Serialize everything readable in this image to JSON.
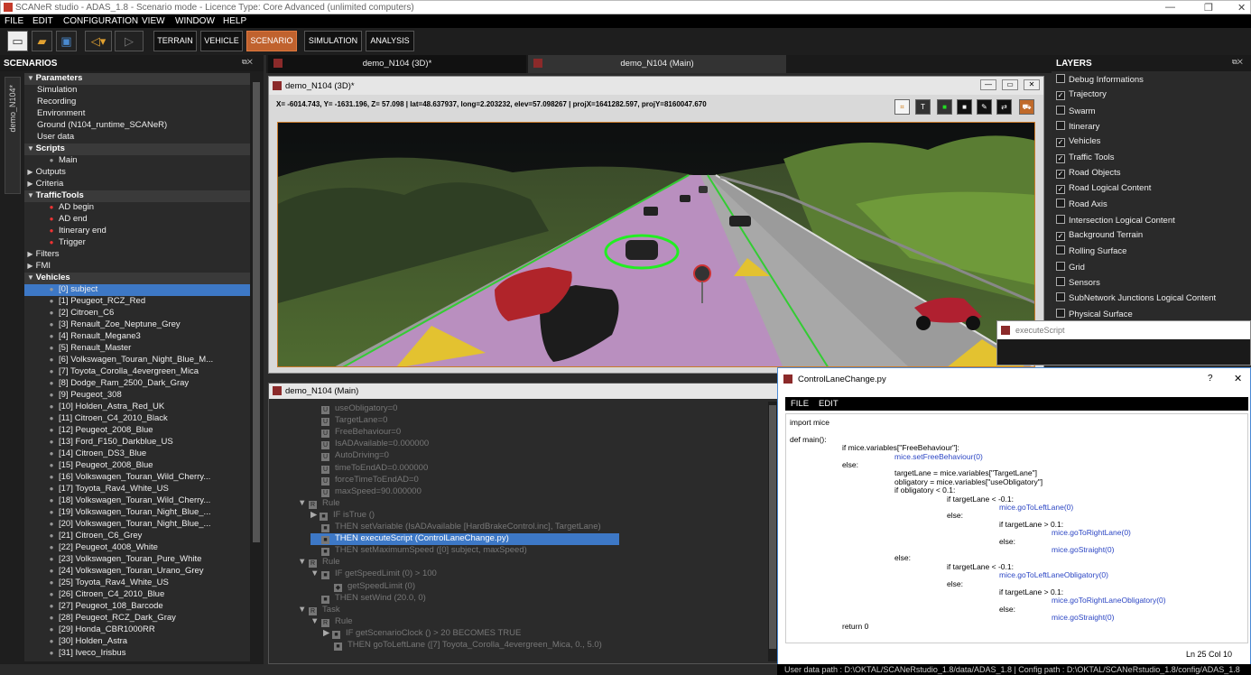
{
  "title": "SCANeR studio - ADAS_1.8 - Scenario mode - Licence Type: Core Advanced (unlimited computers)",
  "menu": [
    "FILE",
    "EDIT",
    "CONFIGURATION",
    "VIEW",
    "WINDOW",
    "HELP"
  ],
  "toolbar": {
    "modes": [
      "TERRAIN",
      "VEHICLE",
      "SCENARIO",
      "SIMULATION",
      "ANALYSIS"
    ],
    "active_mode": "SCENARIO"
  },
  "scenarios": {
    "header": "SCENARIOS",
    "vertical_tab": "demo_N104*",
    "tree": [
      {
        "label": "Parameters",
        "kind": "section",
        "indent": 0
      },
      {
        "label": "Simulation",
        "kind": "item",
        "indent": 1
      },
      {
        "label": "Recording",
        "kind": "item",
        "indent": 1
      },
      {
        "label": "Environment",
        "kind": "item",
        "indent": 1
      },
      {
        "label": "Ground (N104_runtime_SCANeR)",
        "kind": "item",
        "indent": 1
      },
      {
        "label": "User data",
        "kind": "item",
        "indent": 1
      },
      {
        "label": "Scripts",
        "kind": "section",
        "indent": 0
      },
      {
        "label": "Main",
        "kind": "item",
        "indent": 2
      },
      {
        "label": "Outputs",
        "kind": "plain",
        "indent": 0
      },
      {
        "label": "Criteria",
        "kind": "plain",
        "indent": 0
      },
      {
        "label": "TrafficTools",
        "kind": "section",
        "indent": 0
      },
      {
        "label": "AD begin",
        "kind": "item",
        "indent": 2
      },
      {
        "label": "AD end",
        "kind": "item",
        "indent": 2
      },
      {
        "label": "Itinerary end",
        "kind": "item",
        "indent": 2
      },
      {
        "label": "Trigger",
        "kind": "item",
        "indent": 2
      },
      {
        "label": "Filters",
        "kind": "plain",
        "indent": 0
      },
      {
        "label": "FMI",
        "kind": "plain",
        "indent": 0
      },
      {
        "label": "Vehicles",
        "kind": "section",
        "indent": 0
      },
      {
        "label": "[0] subject",
        "kind": "selected",
        "indent": 2
      },
      {
        "label": "[1] Peugeot_RCZ_Red",
        "kind": "item",
        "indent": 2
      },
      {
        "label": "[2] Citroen_C6",
        "kind": "item",
        "indent": 2
      },
      {
        "label": "[3] Renault_Zoe_Neptune_Grey",
        "kind": "item",
        "indent": 2
      },
      {
        "label": "[4] Renault_Megane3",
        "kind": "item",
        "indent": 2
      },
      {
        "label": "[5] Renault_Master",
        "kind": "item",
        "indent": 2
      },
      {
        "label": "[6] Volkswagen_Touran_Night_Blue_M...",
        "kind": "item",
        "indent": 2
      },
      {
        "label": "[7] Toyota_Corolla_4evergreen_Mica",
        "kind": "item",
        "indent": 2
      },
      {
        "label": "[8] Dodge_Ram_2500_Dark_Gray",
        "kind": "item",
        "indent": 2
      },
      {
        "label": "[9] Peugeot_308",
        "kind": "item",
        "indent": 2
      },
      {
        "label": "[10] Holden_Astra_Red_UK",
        "kind": "item",
        "indent": 2
      },
      {
        "label": "[11] Citroen_C4_2010_Black",
        "kind": "item",
        "indent": 2
      },
      {
        "label": "[12] Peugeot_2008_Blue",
        "kind": "item",
        "indent": 2
      },
      {
        "label": "[13] Ford_F150_Darkblue_US",
        "kind": "item",
        "indent": 2
      },
      {
        "label": "[14] Citroen_DS3_Blue",
        "kind": "item",
        "indent": 2
      },
      {
        "label": "[15] Peugeot_2008_Blue",
        "kind": "item",
        "indent": 2
      },
      {
        "label": "[16] Volkswagen_Touran_Wild_Cherry...",
        "kind": "item",
        "indent": 2
      },
      {
        "label": "[17] Toyota_Rav4_White_US",
        "kind": "item",
        "indent": 2
      },
      {
        "label": "[18] Volkswagen_Touran_Wild_Cherry...",
        "kind": "item",
        "indent": 2
      },
      {
        "label": "[19] Volkswagen_Touran_Night_Blue_...",
        "kind": "item",
        "indent": 2
      },
      {
        "label": "[20] Volkswagen_Touran_Night_Blue_...",
        "kind": "item",
        "indent": 2
      },
      {
        "label": "[21] Citroen_C6_Grey",
        "kind": "item",
        "indent": 2
      },
      {
        "label": "[22] Peugeot_4008_White",
        "kind": "item",
        "indent": 2
      },
      {
        "label": "[23] Volkswagen_Touran_Pure_White",
        "kind": "item",
        "indent": 2
      },
      {
        "label": "[24] Volkswagen_Touran_Urano_Grey",
        "kind": "item",
        "indent": 2
      },
      {
        "label": "[25] Toyota_Rav4_White_US",
        "kind": "item",
        "indent": 2
      },
      {
        "label": "[26] Citroen_C4_2010_Blue",
        "kind": "item",
        "indent": 2
      },
      {
        "label": "[27] Peugeot_108_Barcode",
        "kind": "item",
        "indent": 2
      },
      {
        "label": "[28] Peugeot_RCZ_Dark_Gray",
        "kind": "item",
        "indent": 2
      },
      {
        "label": "[29] Honda_CBR1000RR",
        "kind": "item",
        "indent": 2
      },
      {
        "label": "[30] Holden_Astra",
        "kind": "item",
        "indent": 2
      },
      {
        "label": "[31] Iveco_Irisbus",
        "kind": "item",
        "indent": 2
      }
    ]
  },
  "doc_tabs": [
    "demo_N104 (3D)*",
    "demo_N104 (Main)"
  ],
  "view3d": {
    "title": "demo_N104 (3D)*",
    "coords": "X= -6014.743, Y= -1631.196, Z=  57.098 | lat=48.637937, long=2.203232, elev=57.098267 | projX=1641282.597, projY=8160047.670",
    "tool_buttons": [
      "frame-icon",
      "T",
      "green-square-icon",
      "white-square-icon",
      "edit-icon",
      "tow-icon",
      "car-icon"
    ]
  },
  "layers": {
    "header": "LAYERS",
    "items": [
      {
        "label": "Debug Informations",
        "checked": false
      },
      {
        "label": "Trajectory",
        "checked": true
      },
      {
        "label": "Swarm",
        "checked": false
      },
      {
        "label": "Itinerary",
        "checked": false
      },
      {
        "label": "Vehicles",
        "checked": true
      },
      {
        "label": "Traffic Tools",
        "checked": true
      },
      {
        "label": "Road Objects",
        "checked": true
      },
      {
        "label": "Road Logical Content",
        "checked": true
      },
      {
        "label": "Road Axis",
        "checked": false
      },
      {
        "label": "Intersection Logical Content",
        "checked": false
      },
      {
        "label": "Background Terrain",
        "checked": true
      },
      {
        "label": "Rolling Surface",
        "checked": false
      },
      {
        "label": "Grid",
        "checked": false
      },
      {
        "label": "Sensors",
        "checked": false
      },
      {
        "label": "SubNetwork Junctions Logical Content",
        "checked": false
      },
      {
        "label": "Physical Surface",
        "checked": false
      }
    ]
  },
  "main_view": {
    "title": "demo_N104 (Main)",
    "rows": [
      {
        "text": "useObligatory=0",
        "indent": 2,
        "style": "dim",
        "icon": "U"
      },
      {
        "text": "TargetLane=0",
        "indent": 2,
        "style": "dim",
        "icon": "U"
      },
      {
        "text": "FreeBehaviour=0",
        "indent": 2,
        "style": "dim",
        "icon": "U"
      },
      {
        "text": "IsADAvailable=0.000000",
        "indent": 2,
        "style": "dim",
        "icon": "U"
      },
      {
        "text": "AutoDriving=0",
        "indent": 2,
        "style": "dim",
        "icon": "U"
      },
      {
        "text": "timeToEndAD=0.000000",
        "indent": 2,
        "style": "dim",
        "icon": "U"
      },
      {
        "text": "forceTimeToEndAD=0",
        "indent": 2,
        "style": "dim",
        "icon": "U"
      },
      {
        "text": "maxSpeed=90.000000",
        "indent": 2,
        "style": "dim",
        "icon": "U"
      },
      {
        "text": "Rule",
        "indent": 1,
        "style": "dim",
        "icon": "R",
        "arrow": "▼"
      },
      {
        "text": "IF   isTrue  ()",
        "indent": 2,
        "style": "dim",
        "icon": "■",
        "arrow": "▶"
      },
      {
        "text": "THEN  setVariable  (IsADAvailable [HardBrakeControl.inc], TargetLane)",
        "indent": 2,
        "style": "dim",
        "icon": "■"
      },
      {
        "text": "THEN  executeScript  (ControlLaneChange.py)",
        "indent": 2,
        "style": "selected",
        "icon": "■"
      },
      {
        "text": "THEN  setMaximumSpeed  ([0] subject,  maxSpeed)",
        "indent": 2,
        "style": "dim",
        "icon": "■"
      },
      {
        "text": "Rule",
        "indent": 1,
        "style": "dim",
        "icon": "R",
        "arrow": "▼"
      },
      {
        "text": "IF   getSpeedLimit  (0)  >  100",
        "indent": 2,
        "style": "dim",
        "icon": "■",
        "arrow": "▼"
      },
      {
        "text": "getSpeedLimit  (0)",
        "indent": 3,
        "style": "dim",
        "icon": "◆"
      },
      {
        "text": "THEN  setWind  (20.0,  0)",
        "indent": 2,
        "style": "dim",
        "icon": "■"
      },
      {
        "text": "Task",
        "indent": 1,
        "style": "dim",
        "icon": "R",
        "arrow": "▼"
      },
      {
        "text": "Rule",
        "indent": 2,
        "style": "dim",
        "icon": "R",
        "arrow": "▼"
      },
      {
        "text": "IF   getScenarioClock  ()  >  20    BECOMES TRUE",
        "indent": 3,
        "style": "dim",
        "icon": "■",
        "arrow": "▶"
      },
      {
        "text": "THEN  goToLeftLane  ([7] Toyota_Corolla_4evergreen_Mica,  0.,  5.0)",
        "indent": 3,
        "style": "dim",
        "icon": "■"
      }
    ]
  },
  "exec_window": {
    "title": "executeScript"
  },
  "editor": {
    "title": "ControlLaneChange.py",
    "help": "?",
    "close": "✕",
    "menu": [
      "FILE",
      "EDIT"
    ],
    "lines": [
      {
        "t": "import mice",
        "i": 0
      },
      {
        "t": "",
        "i": 0
      },
      {
        "t": "def main():",
        "i": 0
      },
      {
        "t": "if mice.variables[\"FreeBehaviour\"]:",
        "i": 1
      },
      {
        "t": "mice.setFreeBehaviour(0)",
        "i": 2
      },
      {
        "t": "else:",
        "i": 1
      },
      {
        "t": "targetLane = mice.variables[\"TargetLane\"]",
        "i": 2
      },
      {
        "t": "obligatory = mice.variables[\"useObligatory\"]",
        "i": 2
      },
      {
        "t": "if obligatory < 0.1:",
        "i": 2
      },
      {
        "t": "if targetLane < -0.1:",
        "i": 3
      },
      {
        "t": "mice.goToLeftLane(0)",
        "i": 4
      },
      {
        "t": "else:",
        "i": 3
      },
      {
        "t": "if targetLane > 0.1:",
        "i": 4
      },
      {
        "t": "mice.goToRightLane(0)",
        "i": 5
      },
      {
        "t": "else:",
        "i": 4
      },
      {
        "t": "mice.goStraight(0)",
        "i": 5
      },
      {
        "t": "else:",
        "i": 2
      },
      {
        "t": "if targetLane < -0.1:",
        "i": 3
      },
      {
        "t": "mice.goToLeftLaneObligatory(0)",
        "i": 4
      },
      {
        "t": "else:",
        "i": 3
      },
      {
        "t": "if targetLane > 0.1:",
        "i": 4
      },
      {
        "t": "mice.goToRightLaneObligatory(0)",
        "i": 5
      },
      {
        "t": "else:",
        "i": 4
      },
      {
        "t": "mice.goStraight(0)",
        "i": 5
      },
      {
        "t": "return 0",
        "i": 1
      }
    ],
    "position": "Ln 25 Col 10"
  },
  "status_bar": "User data path : D:\\OKTAL/SCANeRstudio_1.8/data/ADAS_1.8 | Config path : D:\\OKTAL/SCANeRstudio_1.8/config/ADAS_1.8"
}
